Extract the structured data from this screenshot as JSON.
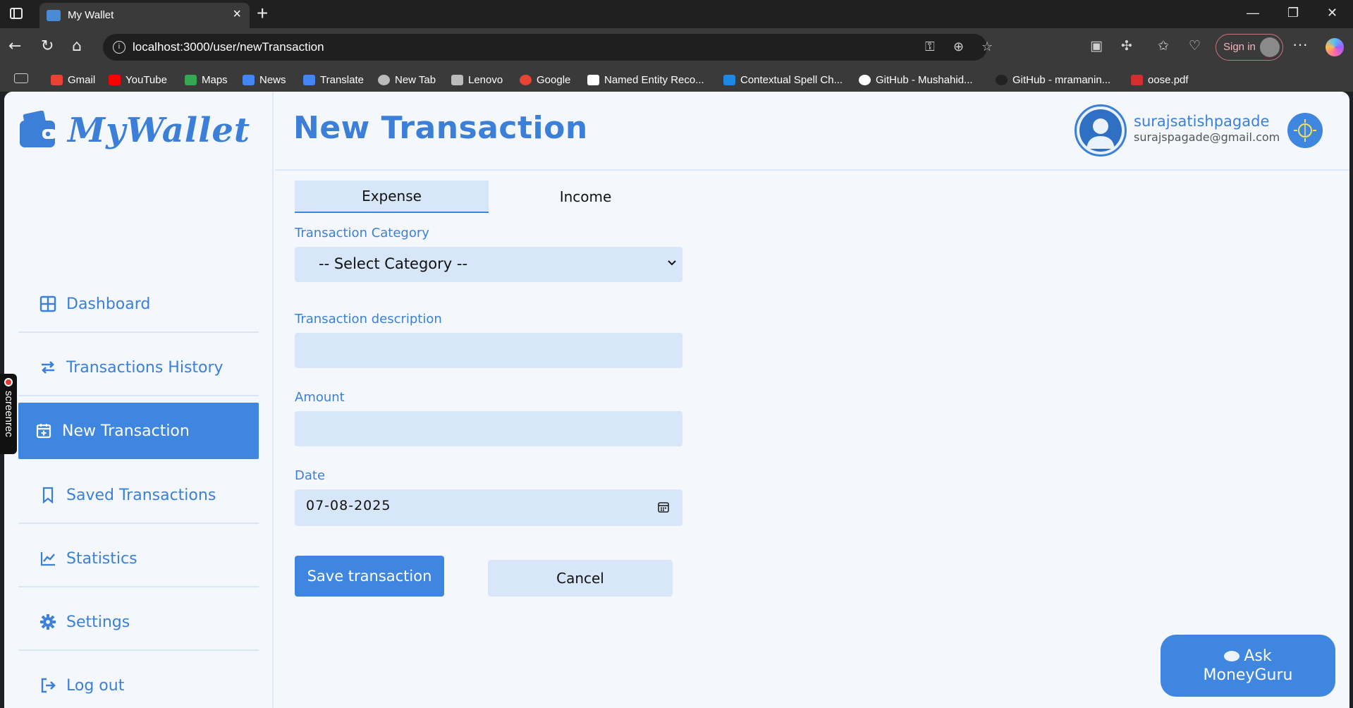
{
  "browser": {
    "tab_title": "My Wallet",
    "url": "localhost:3000/user/newTransaction",
    "sign_in_label": "Sign in",
    "bookmarks": [
      {
        "label": "Gmail",
        "icon": "gmail-icon",
        "color": "#ea4335"
      },
      {
        "label": "YouTube",
        "icon": "youtube-icon",
        "color": "#ff0000"
      },
      {
        "label": "Maps",
        "icon": "maps-icon",
        "color": "#34a853"
      },
      {
        "label": "News",
        "icon": "news-icon",
        "color": "#4285f4"
      },
      {
        "label": "Translate",
        "icon": "translate-icon",
        "color": "#4285f4"
      },
      {
        "label": "New Tab",
        "icon": "globe-icon",
        "color": "#bbbbbb"
      },
      {
        "label": "Lenovo",
        "icon": "folder-icon",
        "color": "#bbbbbb"
      },
      {
        "label": "Google",
        "icon": "google-icon",
        "color": "#ea4335"
      },
      {
        "label": "Named Entity Reco...",
        "icon": "chart-icon",
        "color": "#ffffff"
      },
      {
        "label": "Contextual Spell Ch...",
        "icon": "site-icon",
        "color": "#1e88e5"
      },
      {
        "label": "GitHub - Mushahid...",
        "icon": "github-icon",
        "color": "#ffffff"
      },
      {
        "label": "GitHub - mramanin...",
        "icon": "github-icon",
        "color": "#222222"
      },
      {
        "label": "oose.pdf",
        "icon": "pdf-icon",
        "color": "#d32f2f"
      }
    ]
  },
  "sidebar": {
    "logo_text": "MyWallet",
    "items": [
      {
        "label": "Dashboard",
        "icon": "grid-icon",
        "active": false
      },
      {
        "label": "Transactions History",
        "icon": "arrows-exchange-icon",
        "active": false
      },
      {
        "label": "New Transaction",
        "icon": "calendar-plus-icon",
        "active": true
      },
      {
        "label": "Saved Transactions",
        "icon": "bookmark-icon",
        "active": false
      },
      {
        "label": "Statistics",
        "icon": "line-chart-icon",
        "active": false
      },
      {
        "label": "Settings",
        "icon": "gear-icon",
        "active": false
      },
      {
        "label": "Log out",
        "icon": "logout-icon",
        "active": false
      }
    ]
  },
  "header": {
    "title": "New Transaction",
    "username": "surajsatishpagade",
    "email": "surajspagade@gmail.com"
  },
  "form": {
    "tabs": [
      {
        "label": "Expense",
        "active": true
      },
      {
        "label": "Income",
        "active": false
      }
    ],
    "category_label": "Transaction Category",
    "category_value": "-- Select Category --",
    "description_label": "Transaction description",
    "description_value": "",
    "amount_label": "Amount",
    "amount_value": "",
    "date_label": "Date",
    "date_value": "07-08-2025",
    "save_label": "Save transaction",
    "cancel_label": "Cancel"
  },
  "assistant": {
    "line1": "Ask",
    "line2": "MoneyGuru",
    "icon": "speech-bubble-icon"
  },
  "overlay": {
    "screenrec_label": "screenrec"
  },
  "colors": {
    "accent": "#3e86e0",
    "text_accent": "#3b7fd9",
    "field_bg": "#d7e6f8",
    "page_bg": "#f4f8fd"
  }
}
